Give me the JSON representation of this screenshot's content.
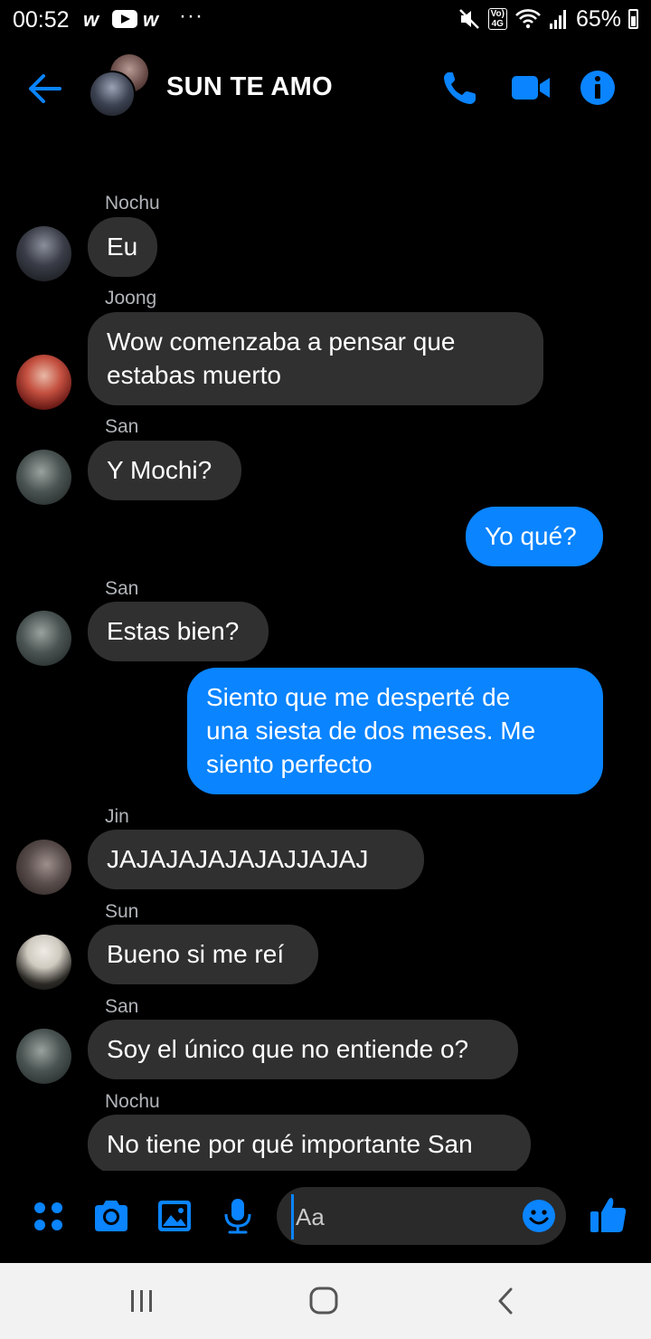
{
  "status_bar": {
    "time": "00:52",
    "notif_w1": "w",
    "notif_w2": "w",
    "overflow": "···",
    "volte": "Vo)\n4G",
    "battery": "65%"
  },
  "header": {
    "title": "SUN TE AMO"
  },
  "messages": [
    {
      "sender": "Nochu",
      "text": "Eu",
      "direction": "in"
    },
    {
      "sender": "Joong",
      "text": "Wow comenzaba a pensar que\nestabas muerto",
      "direction": "in"
    },
    {
      "sender": "San",
      "text": "Y Mochi?",
      "direction": "in"
    },
    {
      "text": "Yo qué?",
      "direction": "out"
    },
    {
      "sender": "San",
      "text": "Estas bien?",
      "direction": "in"
    },
    {
      "text": "Siento que me desperté de\nuna siesta de dos meses. Me\nsiento perfecto",
      "direction": "out"
    },
    {
      "sender": "Jin",
      "text": "JAJAJAJAJAJAJJAJAJ",
      "direction": "in"
    },
    {
      "sender": "Sun",
      "text": "Bueno si me reí",
      "direction": "in"
    },
    {
      "sender": "San",
      "text": "Soy el único que no entiende o?",
      "direction": "in"
    },
    {
      "sender": "Nochu",
      "text": "No tiene por qué importante San",
      "direction": "in"
    }
  ],
  "composer": {
    "placeholder": "Aa"
  },
  "colors": {
    "accent": "#0a84ff",
    "incoming_bubble": "#303030",
    "background": "#000000"
  }
}
